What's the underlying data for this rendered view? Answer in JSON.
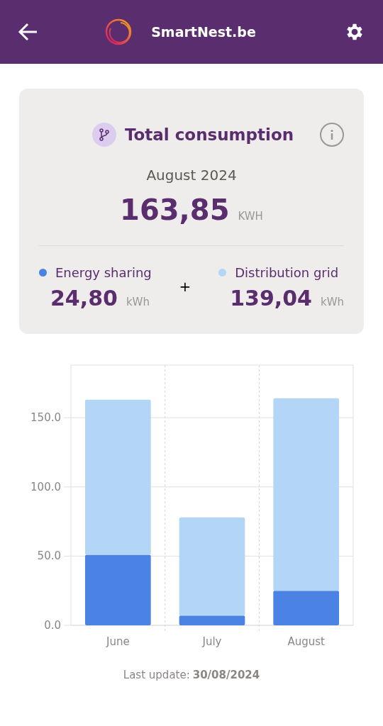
{
  "header": {
    "title": "SmartNest.be"
  },
  "summary": {
    "title": "Total consumption",
    "period": "August 2024",
    "total": "163,85",
    "total_unit": "KWH",
    "parts": [
      {
        "label": "Energy sharing",
        "color": "#4a83e4",
        "value": "24,80",
        "unit": "kWh"
      },
      {
        "label": "Distribution grid",
        "color": "#b3d6f6",
        "value": "139,04",
        "unit": "kWh"
      }
    ],
    "operator": "+"
  },
  "chart": {
    "chart_data": {
      "type": "bar",
      "stacked": true,
      "grid": true,
      "categories": [
        "June",
        "July",
        "August"
      ],
      "ylim": [
        0,
        188
      ],
      "yticks": [
        {
          "value": 0,
          "label": "0.0"
        },
        {
          "value": 50,
          "label": "50.0"
        },
        {
          "value": 100,
          "label": "100.0"
        },
        {
          "value": 150,
          "label": "150.0"
        }
      ],
      "series": [
        {
          "color": "#4a83e4",
          "values": [
            51,
            7,
            25
          ]
        },
        {
          "color": "#b3d6f6",
          "values": [
            112,
            71,
            139
          ]
        }
      ]
    }
  },
  "footer": {
    "label": "Last update:",
    "date": "30/08/2024"
  }
}
